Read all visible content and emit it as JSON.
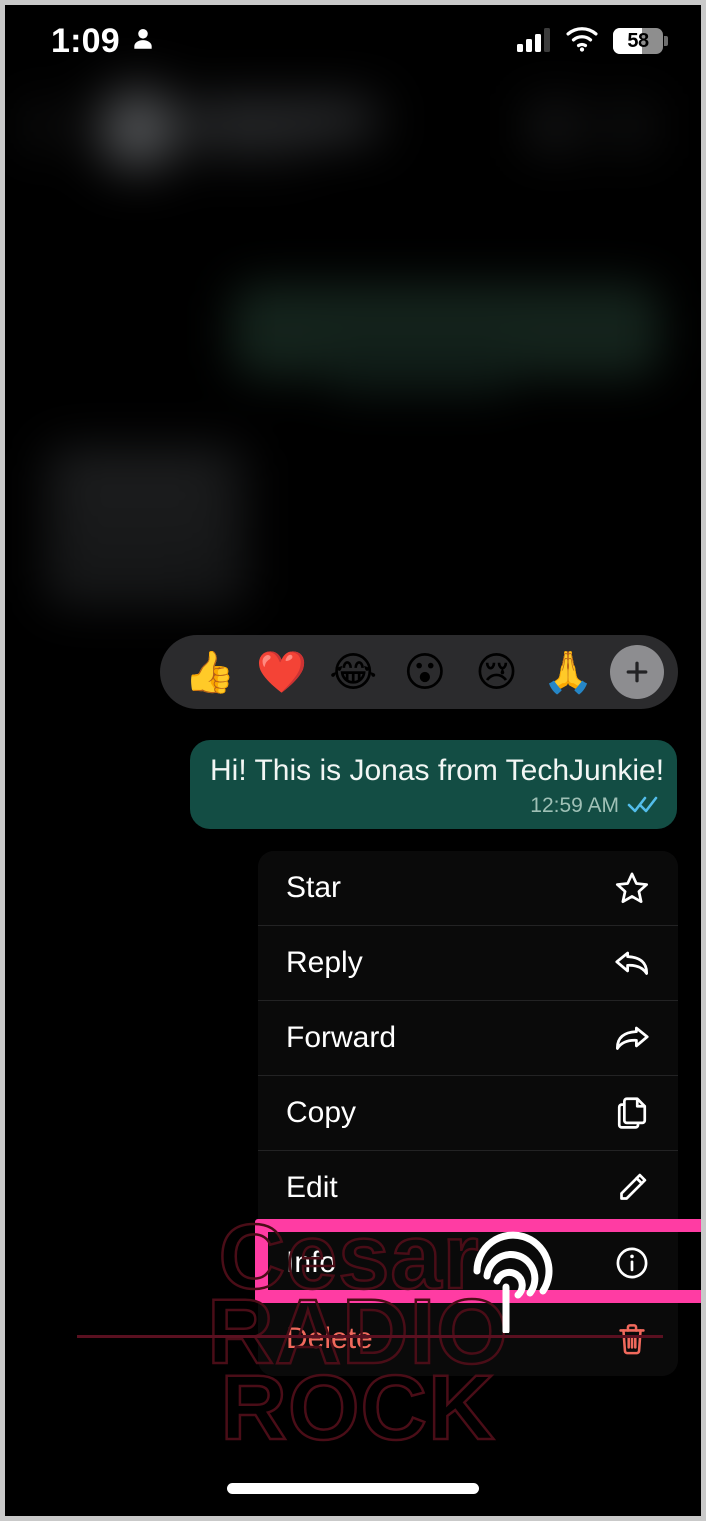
{
  "app": "WhatsApp",
  "platform": "iOS",
  "status_bar": {
    "time": "1:09",
    "person_icon": "person-icon",
    "signal_icon": "cellular-signal-icon",
    "wifi_icon": "wifi-icon",
    "battery_percent": "58",
    "battery_level": 58
  },
  "chat": {
    "blurred_header_note": "blurred contact header",
    "blurred_bubbles_note": "blurred prior messages"
  },
  "reaction_bar": {
    "emojis": [
      {
        "name": "thumbs-up",
        "glyph": "👍"
      },
      {
        "name": "red-heart",
        "glyph": "❤️"
      },
      {
        "name": "tears-of-joy",
        "glyph": "😂"
      },
      {
        "name": "open-mouth",
        "glyph": "😮"
      },
      {
        "name": "crying-face",
        "glyph": "😢"
      },
      {
        "name": "folded-hands",
        "glyph": "🙏"
      }
    ],
    "more_label": "+"
  },
  "message": {
    "text": "Hi! This is Jonas from TechJunkie!",
    "time": "12:59 AM",
    "status": "read",
    "status_icon": "double-check-icon",
    "bubble_color": "#134d44",
    "tick_color": "#53bdeb"
  },
  "context_menu": {
    "items": [
      {
        "label": "Star",
        "icon": "star-icon",
        "danger": false
      },
      {
        "label": "Reply",
        "icon": "reply-icon",
        "danger": false
      },
      {
        "label": "Forward",
        "icon": "forward-icon",
        "danger": false
      },
      {
        "label": "Copy",
        "icon": "copy-icon",
        "danger": false
      },
      {
        "label": "Edit",
        "icon": "pencil-icon",
        "danger": false
      },
      {
        "label": "Info",
        "icon": "info-icon",
        "danger": false
      },
      {
        "label": "Delete",
        "icon": "trash-icon",
        "danger": true
      }
    ]
  },
  "annotation": {
    "highlight_color": "#ff3ca3",
    "highlight_target": "Info",
    "tap_icon": "fingerprint-tap-icon"
  },
  "watermark": {
    "line1": "Cesar",
    "line2": "RADIO",
    "line3": "ROCK",
    "color": "#4a0d17"
  },
  "home_indicator": "home-indicator"
}
